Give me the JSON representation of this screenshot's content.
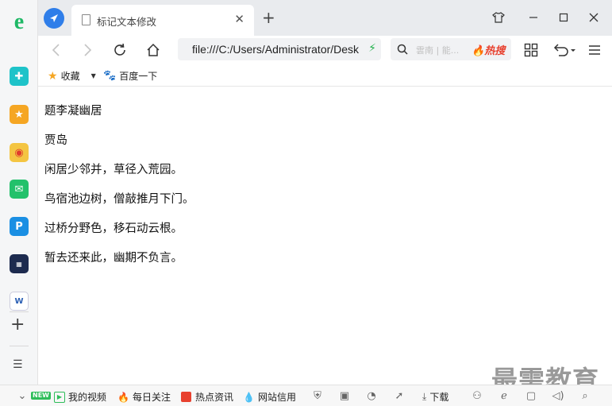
{
  "browser": {
    "tab": {
      "title": "标记文本修改"
    },
    "address": {
      "url": "file:///C:/Users/Administrator/Desktop/"
    },
    "search": {
      "placeholder": "雲南 | 能...",
      "hot_label": "热搜"
    }
  },
  "bookmarks": {
    "favorites_label": "收藏",
    "baidu_label": "百度一下"
  },
  "page": {
    "lines": [
      "题李凝幽居",
      "贾岛",
      "闲居少邻并，草径入荒园。",
      "鸟宿池边树，僧敲推月下门。",
      "过桥分野色，移石动云根。",
      "暂去还来此，幽期不负言。"
    ]
  },
  "statusbar": {
    "new_badge": "NEW",
    "my_video": "我的视频",
    "daily_focus": "每日关注",
    "hot_news": "热点资讯",
    "site_trust": "网站信用",
    "download": "下载"
  },
  "watermark": "最需教育",
  "colors": {
    "accent_blue": "#2f7ee9",
    "ie_green": "#1fb866",
    "hot_red": "#e8412f"
  }
}
